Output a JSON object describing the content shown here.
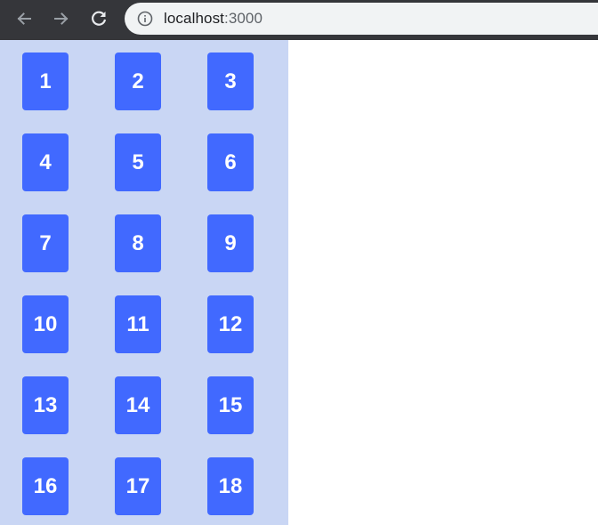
{
  "browser": {
    "url_host": "localhost",
    "url_port": ":3000",
    "icons": {
      "back": "arrow-left-icon",
      "forward": "arrow-right-icon",
      "reload": "reload-icon",
      "site_info": "info-circle-icon"
    },
    "colors": {
      "toolbar": "#35363a",
      "omnibox": "#f1f3f4"
    }
  },
  "grid": {
    "colors": {
      "panel": "#c9d6f4",
      "tile": "#4169ff",
      "tile_text": "#ffffff"
    },
    "items": [
      "1",
      "2",
      "3",
      "4",
      "5",
      "6",
      "7",
      "8",
      "9",
      "10",
      "11",
      "12",
      "13",
      "14",
      "15",
      "16",
      "17",
      "18"
    ]
  }
}
